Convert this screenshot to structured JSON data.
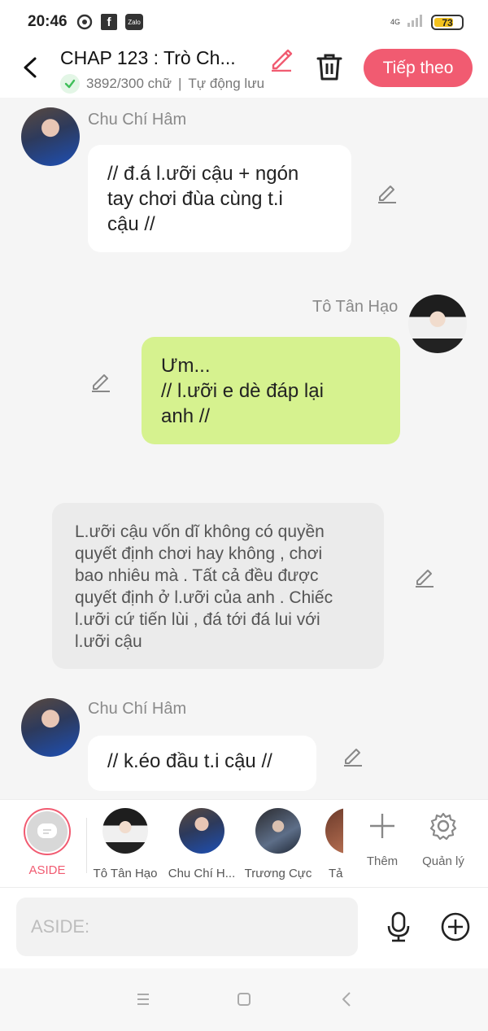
{
  "status_bar": {
    "time": "20:46",
    "icons": [
      "target-icon",
      "facebook-icon",
      "zalo-icon"
    ],
    "facebook_glyph": "f",
    "zalo_glyph": "Zalo",
    "network": "4G",
    "battery": "73",
    "battery_level": 0.73,
    "battery_color": "#f4c21e"
  },
  "header": {
    "title": "CHAP 123 : Trò Ch...",
    "word_count": "3892/300 chữ",
    "autosave": "Tự động lưu",
    "next_label": "Tiếp theo",
    "accent_color": "#f15b71"
  },
  "messages": [
    {
      "sender": "Chu Chí Hâm",
      "lines": [
        "// đ.á l.ưỡi cậu + ngón",
        "tay chơi đùa cùng t.i",
        "cậu //"
      ]
    },
    {
      "sender": "Tô Tân Hạo",
      "lines": [
        "Ưm...",
        "// l.ưỡi e dè đáp lại",
        "anh //"
      ]
    },
    {
      "sender": "",
      "lines": [
        "L.ưỡi cậu vốn dĩ không có quyền",
        "quyết định chơi hay không , chơi",
        "bao nhiêu mà . Tất cả đều được",
        "quyết định ở l.ưỡi của anh . Chiếc",
        "l.ưỡi cứ tiến lùi , đá tới đá lui với",
        "l.ưỡi cậu"
      ]
    },
    {
      "sender": "Chu Chí Hâm",
      "lines": [
        "// k.éo đầu t.i cậu //"
      ]
    }
  ],
  "characters": [
    {
      "label": "ASIDE"
    },
    {
      "label": "Tô Tân Hạo"
    },
    {
      "label": "Chu Chí H..."
    },
    {
      "label": "Trương Cực"
    },
    {
      "label": "Tả"
    }
  ],
  "tools": {
    "add_label": "Thêm",
    "manage_label": "Quản lý"
  },
  "input": {
    "placeholder": "ASIDE:",
    "value": ""
  }
}
